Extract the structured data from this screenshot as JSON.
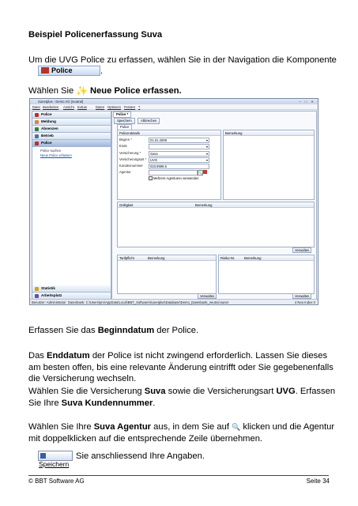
{
  "page": {
    "title": "Beispiel Policenerfassung Suva",
    "para1": "Um die UVG Police zu erfassen, wählen Sie in der Navigation die Komponente",
    "component_label": "Police",
    "para1_end": ".",
    "para2_prefix": "Wählen Sie",
    "para2_label": "Neue Police erfassen.",
    "para3_prefix": "Erfassen Sie das ",
    "para3_bold": "Beginndatum",
    "para3_suffix": " der Police.",
    "para4_prefix": "Das ",
    "para4_bold": "Enddatum",
    "para4_suffix": " der Police ist nicht zwingend erforderlich. Lassen Sie dieses am besten offen, bis eine relevante Änderung eintrifft oder Sie gegebenenfalls die Versicherung wechseln.",
    "para5_a": "Wählen Sie die Versicherung ",
    "para5_b": "Suva",
    "para5_c": " sowie die Versicherungsart ",
    "para5_d": "UVG",
    "para5_e": ". Erfassen Sie Ihre ",
    "para5_f": "Suva Kundennummer",
    "para5_g": ".",
    "para6_a": "Wählen Sie Ihre ",
    "para6_b": "Suva Agentur",
    "para6_c": " aus, in dem Sie auf ",
    "para6_d": " klicken und die Agentur mit doppelklicken auf die entsprechende Zeile übernehmen.",
    "save_button": "Speichern",
    "para7": "Sie anschliessend Ihre Angaben.",
    "footer_left": "© BBT Software AG",
    "footer_right": "Seite 34"
  },
  "app": {
    "title": "Sunetplus - Demo AG (neutral)",
    "menu": [
      "Datei",
      "Bearbeiten",
      "Ansicht",
      "Extras",
      "Daten",
      "Optionen",
      "Fenster",
      "?"
    ],
    "nav": {
      "police": "Police",
      "meldung": "Meldung",
      "absenzen": "Absenzen",
      "betrieb": "Betrieb",
      "police_sub_search": "Police suchen",
      "police_sub_new": "Neue Police erfassen",
      "statistik": "Statistik",
      "arbeitsplatz": "Arbeitsplatz"
    },
    "tabs": {
      "police": "Police *",
      "inner": "Police"
    },
    "toolbar": {
      "save": "Speichern",
      "cancel": "Abbrechen"
    },
    "details": {
      "header": "Policendetails",
      "beginn_label": "Beginn *",
      "beginn_value": "01.01.2009",
      "ende_label": "Ende",
      "versicherung_label": "Versicherung *",
      "versicherung_value": "Suva",
      "art_label": "Versicherungsart *",
      "art_value": "UVG",
      "kundennummer_label": "Kundennummer",
      "kundennummer_value": "023.8998.5",
      "agentur_label": "Agentur",
      "checkbox_label": "Mehrere Agenturen verwenden"
    },
    "bemerkung_header": "Bemerkung",
    "grid1": {
      "col1": "Gültigkeit",
      "col2": "Bemerkung",
      "button": "Verwalten"
    },
    "grid2": {
      "col1": "Tarifpflicht",
      "col2": "Bemerkung",
      "button": "Verwalten"
    },
    "grid3": {
      "col1": "Risiko-Nr.",
      "col2": "Bemerkung",
      "button": "Verwalten"
    },
    "status": {
      "user": "Benutzer: Administrator",
      "db": "Datenbank: C:\\Users\\pm\\AppData\\Local\\BBT_Software\\Sunetplus\\Database\\Demo_Datenbank_neutral.sunet",
      "index": "4 Neu Index 0"
    }
  }
}
